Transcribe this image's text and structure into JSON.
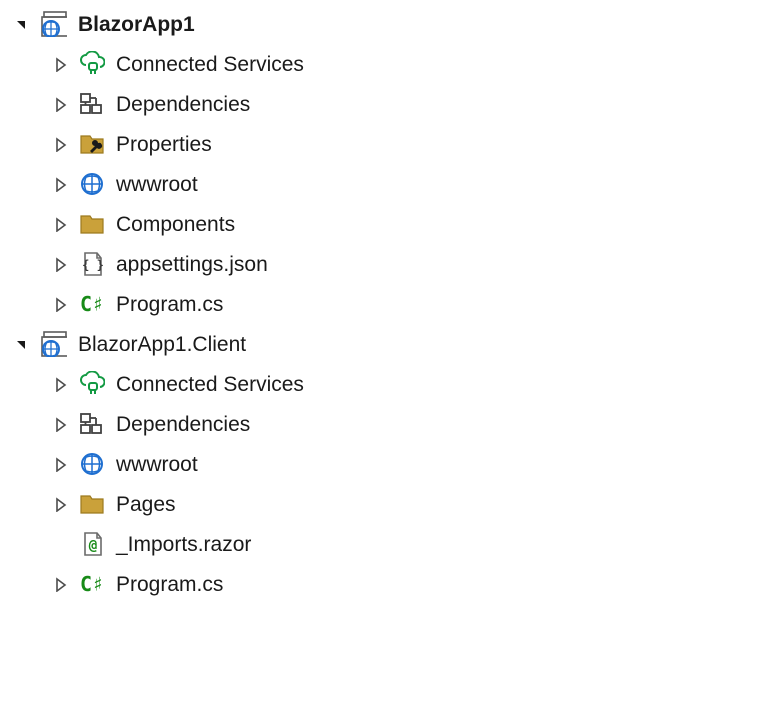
{
  "tree": [
    {
      "name": "project-blazorapp1",
      "label": "BlazorApp1",
      "icon": "blazor-project",
      "indent": 0,
      "expandState": "open",
      "bold": true
    },
    {
      "name": "connected-services-1",
      "label": "Connected Services",
      "icon": "cloud-plug",
      "indent": 1,
      "expandState": "closed"
    },
    {
      "name": "dependencies-1",
      "label": "Dependencies",
      "icon": "dependencies",
      "indent": 1,
      "expandState": "closed"
    },
    {
      "name": "properties-1",
      "label": "Properties",
      "icon": "folder-wrench",
      "indent": 1,
      "expandState": "closed"
    },
    {
      "name": "wwwroot-1",
      "label": "wwwroot",
      "icon": "globe",
      "indent": 1,
      "expandState": "closed"
    },
    {
      "name": "components-1",
      "label": "Components",
      "icon": "folder",
      "indent": 1,
      "expandState": "closed"
    },
    {
      "name": "appsettings-json",
      "label": "appsettings.json",
      "icon": "json-file",
      "indent": 1,
      "expandState": "closed"
    },
    {
      "name": "program-cs-1",
      "label": "Program.cs",
      "icon": "csharp",
      "indent": 1,
      "expandState": "closed"
    },
    {
      "name": "project-blazorapp1-client",
      "label": "BlazorApp1.Client",
      "icon": "blazor-project",
      "indent": 0,
      "expandState": "open"
    },
    {
      "name": "connected-services-2",
      "label": "Connected Services",
      "icon": "cloud-plug",
      "indent": 1,
      "expandState": "closed"
    },
    {
      "name": "dependencies-2",
      "label": "Dependencies",
      "icon": "dependencies",
      "indent": 1,
      "expandState": "closed"
    },
    {
      "name": "wwwroot-2",
      "label": "wwwroot",
      "icon": "globe",
      "indent": 1,
      "expandState": "closed"
    },
    {
      "name": "pages-2",
      "label": "Pages",
      "icon": "folder",
      "indent": 1,
      "expandState": "closed"
    },
    {
      "name": "imports-razor",
      "label": "_Imports.razor",
      "icon": "razor-file",
      "indent": 1,
      "expandState": "none"
    },
    {
      "name": "program-cs-2",
      "label": "Program.cs",
      "icon": "csharp",
      "indent": 1,
      "expandState": "closed"
    }
  ]
}
